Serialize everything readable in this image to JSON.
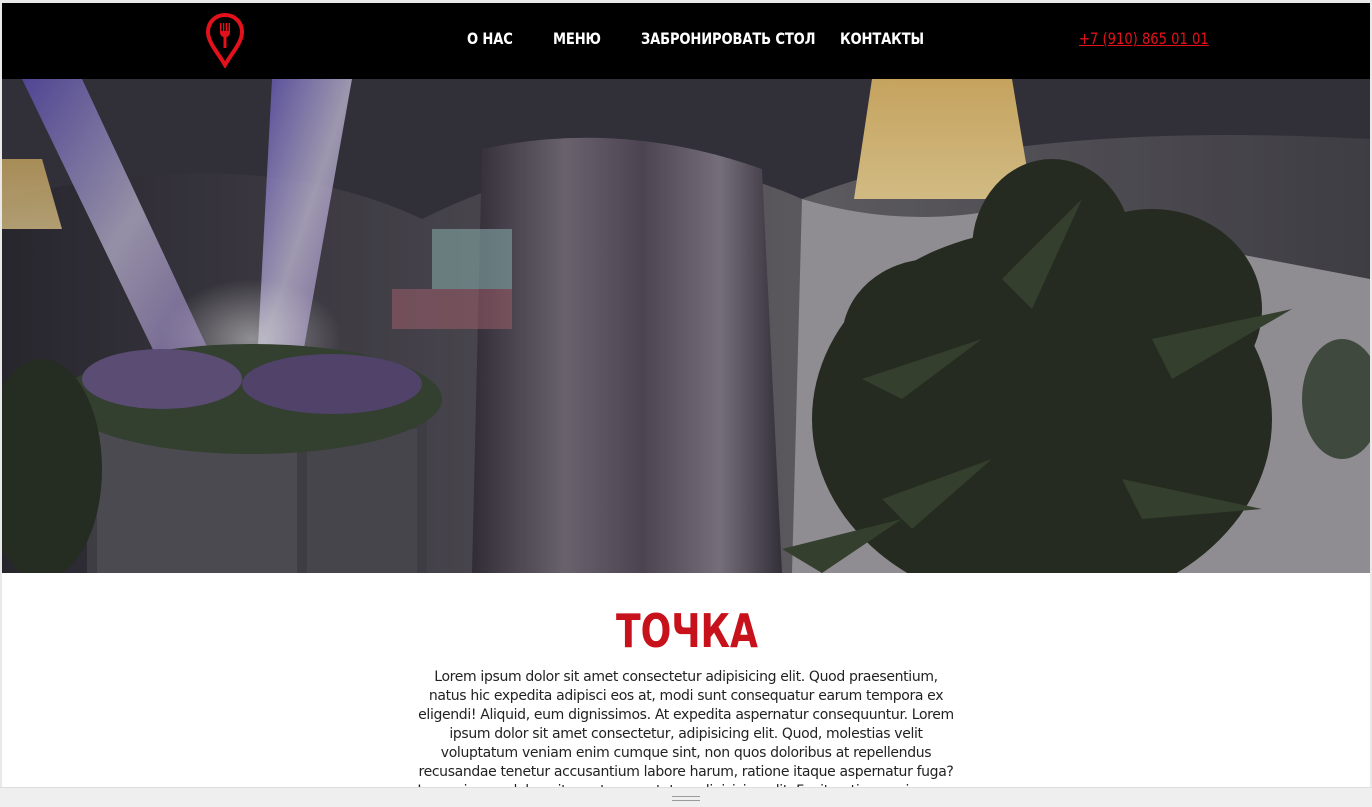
{
  "header": {
    "nav": [
      {
        "label": "О НАС"
      },
      {
        "label": "МЕНЮ"
      },
      {
        "label": "ЗАБРОНИРОВАТЬ СТОЛ"
      },
      {
        "label": "КОНТАКТЫ"
      }
    ],
    "phone": "+7 (910) 865 01 01",
    "logo_icon": "fork-location-pin-icon"
  },
  "hero": {
    "image": "restaurant-interior-photo"
  },
  "content": {
    "brand": "ТОЧКА",
    "description": "Lorem ipsum dolor sit amet consectetur adipisicing elit. Quod praesentium, natus hic expedita adipisci eos at, modi sunt consequatur earum tempora ex eligendi! Aliquid, eum dignissimos. At expedita aspernatur consequuntur. Lorem ipsum dolor sit amet consectetur, adipisicing elit. Quod, molestias velit voluptatum veniam enim cumque sint, non quos doloribus at repellendus recusandae tenetur accusantium labore harum, ratione itaque aspernatur fuga? Lorem ipsum dolor, sit amet consectetur adipisicing elit. Fugit, ratione quisquam consequatur"
  },
  "colors": {
    "accent": "#e3111b",
    "header_bg": "#000000",
    "text": "#222222"
  },
  "footer": {
    "resize_handle": "drag-handle-icon"
  }
}
